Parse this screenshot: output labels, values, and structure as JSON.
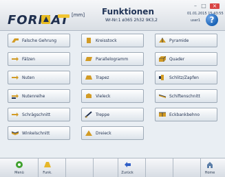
{
  "header": {
    "logo": "FORMAT",
    "unit_label": "[mm]",
    "title": "Funktionen",
    "subtitle": "Wr-Nr:1 ø365 2h32 9K3,2",
    "datetime": "01.01.2015 15:43:55",
    "user": "user1",
    "help": "?"
  },
  "functions": [
    [
      {
        "label": "Falsche Gehrung",
        "icon": "miter-icon"
      },
      {
        "label": "Fälzen",
        "icon": "rebate-icon"
      },
      {
        "label": "Nuten",
        "icon": "groove-icon"
      },
      {
        "label": "Nutenreihe",
        "icon": "groove-row-icon"
      },
      {
        "label": "Schrägschnitt",
        "icon": "bevel-cut-icon"
      },
      {
        "label": "Winkelschnitt",
        "icon": "angle-cut-icon"
      }
    ],
    [
      {
        "label": "Kreisstock",
        "icon": "circle-stock-icon"
      },
      {
        "label": "Parallelogramm",
        "icon": "parallelogram-icon"
      },
      {
        "label": "Trapez",
        "icon": "trapezoid-icon"
      },
      {
        "label": "Vieleck",
        "icon": "polygon-icon"
      },
      {
        "label": "Treppe",
        "icon": "stairs-icon"
      },
      {
        "label": "Dreieck",
        "icon": "triangle-icon"
      }
    ],
    [
      {
        "label": "Pyramide",
        "icon": "pyramid-icon"
      },
      {
        "label": "Quader",
        "icon": "cuboid-icon"
      },
      {
        "label": "Schlitz/Zapfen",
        "icon": "tenon-icon"
      },
      {
        "label": "Schiftenschnitt",
        "icon": "rafter-cut-icon"
      },
      {
        "label": "Eckbankbehno",
        "icon": "corner-bench-icon"
      }
    ]
  ],
  "footer": {
    "menu": "Menü",
    "funk": "Funk.",
    "back": "Zurück",
    "home": "Home"
  },
  "colors": {
    "accent": "#f1c532",
    "brand": "#1f2f4e",
    "help": "#1a63b6"
  }
}
